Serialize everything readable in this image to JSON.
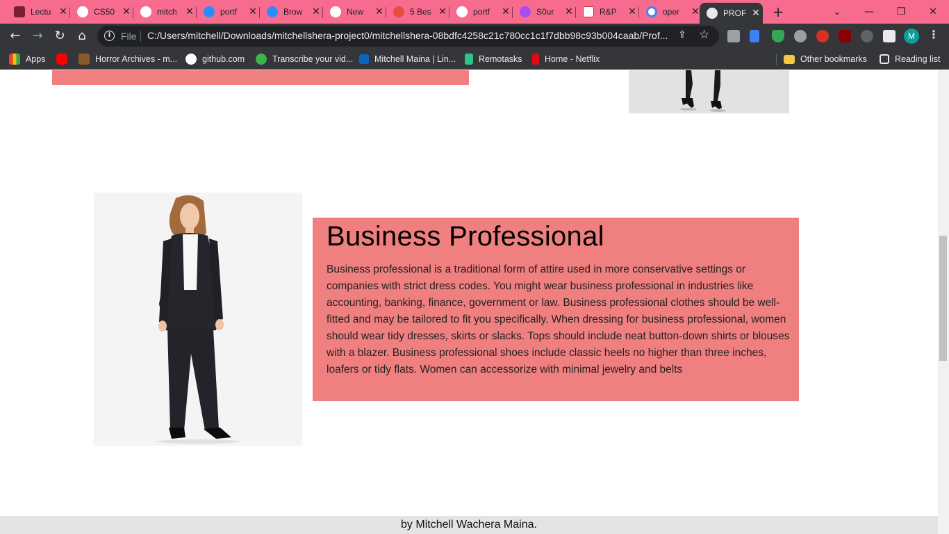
{
  "browser": {
    "tabs": [
      {
        "title": "Lectu",
        "icon": "university-crest-icon",
        "color": "#7a1f2b"
      },
      {
        "title": "CS50",
        "icon": "globe-icon",
        "color": "#ffffff"
      },
      {
        "title": "mitch",
        "icon": "github-icon",
        "color": "#ffffff"
      },
      {
        "title": "portf",
        "icon": "canva-icon",
        "color": "#2b8cff"
      },
      {
        "title": "Brow",
        "icon": "canva-icon",
        "color": "#2b8cff"
      },
      {
        "title": "New",
        "icon": "globe-icon",
        "color": "#ffffff"
      },
      {
        "title": "5 Bes",
        "icon": "s-logo-icon",
        "color": "#e94b3c"
      },
      {
        "title": "portf",
        "icon": "github-icon",
        "color": "#ffffff"
      },
      {
        "title": "S0ur",
        "icon": "s0urce-icon",
        "color": "#a64df5"
      },
      {
        "title": "R&P",
        "icon": "rp-logo-icon",
        "color": "#ffffff"
      },
      {
        "title": "oper",
        "icon": "google-icon",
        "color": "#ffffff"
      },
      {
        "title": "PROF",
        "icon": "globe-icon",
        "color": "#e8eaed"
      }
    ],
    "address": {
      "scheme_label": "File",
      "url": "C:/Users/mitchell/Downloads/mitchellshera-project0/mitchellshera-08bdfc4258c21c780cc1c1f7dbb98c93b004caab/Prof..."
    },
    "profile_initial": "M",
    "bookmarks": [
      {
        "label": "Apps",
        "icon": "apps-grid-icon",
        "color": "#4285f4"
      },
      {
        "label": "",
        "icon": "youtube-icon",
        "color": "#ff0000"
      },
      {
        "label": "Horror Archives - m...",
        "icon": "horror-archives-icon",
        "color": "#8b5a2b"
      },
      {
        "label": "github.com",
        "icon": "github-icon",
        "color": "#ffffff"
      },
      {
        "label": "Transcribe your vid...",
        "icon": "transcribe-icon",
        "color": "#3ab54a"
      },
      {
        "label": "Mitchell Maina | Lin...",
        "icon": "linkedin-icon",
        "color": "#0a66c2"
      },
      {
        "label": "Remotasks",
        "icon": "remotasks-icon",
        "color": "#2fc38a"
      },
      {
        "label": "Home - Netflix",
        "icon": "netflix-icon",
        "color": "#e50914"
      },
      {
        "label": "Other bookmarks",
        "icon": "folder-icon",
        "color": "#f6c744"
      },
      {
        "label": "Reading list",
        "icon": "reading-list-icon",
        "color": "#e8eaed"
      }
    ]
  },
  "page": {
    "section": {
      "heading": "Business Professional",
      "body": "Business professional is a traditional form of attire used in more conservative settings or companies with strict dress codes. You might wear business professional in industries like accounting, banking, finance, government or law. Business professional clothes should be well-fitted and may be tailored to fit you specifically. When dressing for business professional, women should wear tidy dresses, skirts or slacks. Tops should include neat button-down shirts or blouses with a blazer. Business professional shoes include classic heels no higher than three inches, loafers or tidy flats. Women can accessorize with minimal jewelry and belts"
    },
    "footer": "by Mitchell Wachera Maina.",
    "colors": {
      "card_bg": "#f07f7f",
      "tabstrip_bg": "#f76b8f",
      "toolbar_bg": "#35363a"
    }
  }
}
